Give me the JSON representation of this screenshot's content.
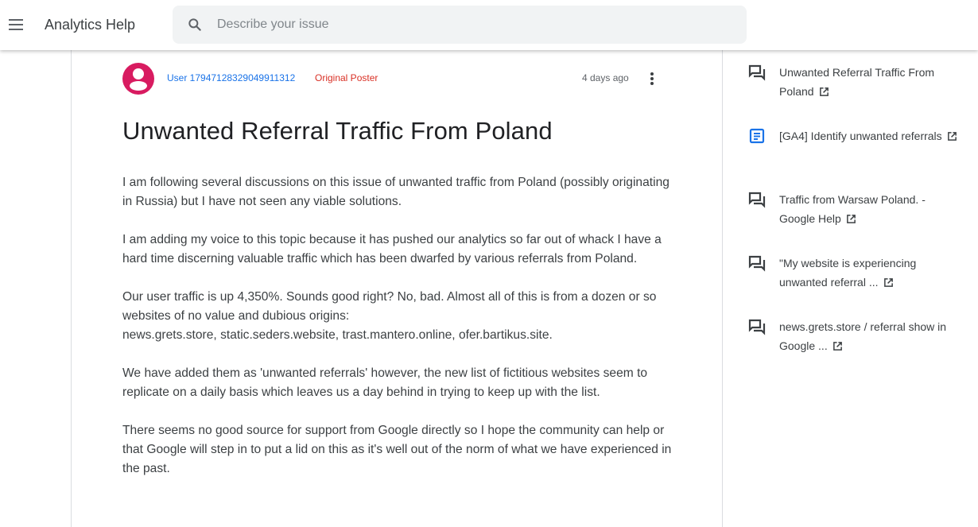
{
  "header": {
    "menu_icon": "hamburger-menu-icon",
    "app_title": "Analytics Help",
    "search": {
      "placeholder": "Describe your issue",
      "value": "",
      "icon": "search-icon"
    }
  },
  "post": {
    "author": "User 17947128329049911312",
    "badge": "Original Poster",
    "timestamp": "4 days ago",
    "more_icon": "more-vert-icon",
    "title": "Unwanted Referral Traffic From Poland",
    "paragraphs": [
      "I am following several discussions on this issue of unwanted traffic from Poland (possibly originating in Russia) but I have not seen any viable solutions.",
      "I am adding my voice to this topic because it has pushed our analytics so far out of whack I have a hard time discerning valuable traffic which has been dwarfed by various referrals from Poland.",
      "Our user traffic is up 4,350%. Sounds good right? No, bad. Almost all of this is from a dozen or so websites of no value and dubious origins:",
      "news.grets.store, static.seders.website, trast.mantero.online, ofer.bartikus.site.",
      "We have added them as 'unwanted referrals' however, the new list of fictitious websites seem to replicate on a daily basis which leaves us a day behind in trying to keep up with the list.",
      "There seems no good source for support from Google directly so I hope the community can help or that Google will step in to put a lid on this as it's well out of the norm of what we have experienced in the past."
    ],
    "avatar_color": "#d81b60"
  },
  "related": [
    {
      "icon": "forum-icon",
      "label": "Unwanted Referral Traffic From Poland"
    },
    {
      "icon": "article-icon",
      "label": "[GA4] Identify unwanted referrals"
    },
    {
      "icon": "forum-icon",
      "label": "Traffic from Warsaw Poland. - Google Help"
    },
    {
      "icon": "forum-icon",
      "label": "\"My website is experiencing unwanted referral ..."
    },
    {
      "icon": "forum-icon",
      "label": "news.grets.store / referral show in Google ..."
    }
  ],
  "colors": {
    "link": "#1a73e8",
    "badge": "#d93025",
    "article_icon": "#1a73e8"
  }
}
